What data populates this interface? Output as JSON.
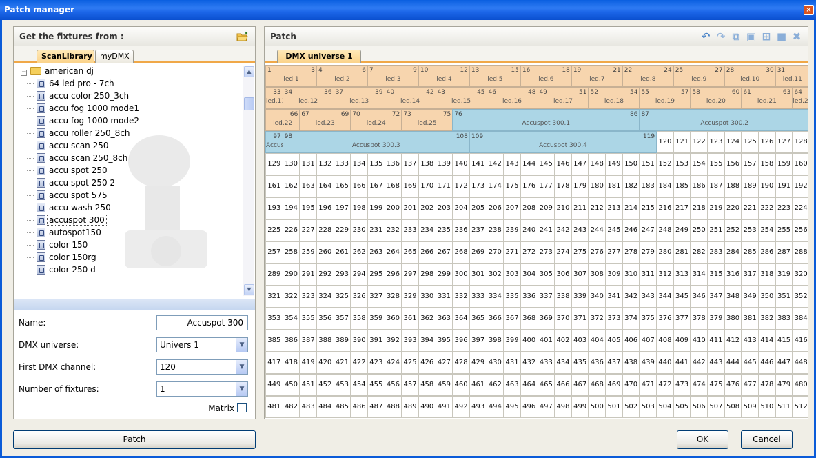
{
  "window": {
    "title": "Patch manager",
    "close_glyph": "×"
  },
  "left": {
    "header": "Get the fixtures from :",
    "tabs": [
      "ScanLibrary",
      "myDMX"
    ],
    "tree": {
      "root": "american dj",
      "items": [
        "64 led pro - 7ch",
        "accu color 250_3ch",
        "accu fog 1000 mode1",
        "accu fog 1000 mode2",
        "accu roller 250_8ch",
        "accu scan 250",
        "accu scan 250_8ch",
        "accu spot 250",
        "accu spot 250 2",
        "accu spot 575",
        "accu wash 250",
        "accuspot 300",
        "autospot150",
        "color 150",
        "color 150rg",
        "color 250 d"
      ],
      "selected": "accuspot 300"
    },
    "form": {
      "name_label": "Name:",
      "name_value": "Accuspot 300",
      "universe_label": "DMX universe:",
      "universe_value": "Univers 1",
      "channel_label": "First DMX channel:",
      "channel_value": "120",
      "count_label": "Number of fixtures:",
      "count_value": "1",
      "matrix_label": "Matrix"
    },
    "patch_button": "Patch"
  },
  "right": {
    "header": "Patch",
    "tab": "DMX universe 1",
    "toolbar": [
      "undo-icon",
      "redo-icon",
      "copy-icon",
      "paste-icon",
      "insert-icon",
      "square-icon",
      "delete-icon"
    ],
    "ok_button": "OK",
    "cancel_button": "Cancel"
  },
  "patch_grid": {
    "channels_per_row": 32,
    "total_channels": 512,
    "patched": [
      {
        "label": "led.1",
        "start": 1,
        "end": 3
      },
      {
        "label": "led.2",
        "start": 4,
        "end": 6
      },
      {
        "label": "led.3",
        "start": 7,
        "end": 9
      },
      {
        "label": "led.4",
        "start": 10,
        "end": 12
      },
      {
        "label": "led.5",
        "start": 13,
        "end": 15
      },
      {
        "label": "led.6",
        "start": 16,
        "end": 18
      },
      {
        "label": "led.7",
        "start": 19,
        "end": 21
      },
      {
        "label": "led.8",
        "start": 22,
        "end": 24
      },
      {
        "label": "led.9",
        "start": 25,
        "end": 27
      },
      {
        "label": "led.10",
        "start": 28,
        "end": 30
      },
      {
        "label": "led.11",
        "start": 31,
        "end": 33
      },
      {
        "label": "led.12",
        "start": 34,
        "end": 36
      },
      {
        "label": "led.13",
        "start": 37,
        "end": 39
      },
      {
        "label": "led.14",
        "start": 40,
        "end": 42
      },
      {
        "label": "led.15",
        "start": 43,
        "end": 45
      },
      {
        "label": "led.16",
        "start": 46,
        "end": 48
      },
      {
        "label": "led.17",
        "start": 49,
        "end": 51
      },
      {
        "label": "led.18",
        "start": 52,
        "end": 54
      },
      {
        "label": "led.19",
        "start": 55,
        "end": 57
      },
      {
        "label": "led.20",
        "start": 58,
        "end": 60
      },
      {
        "label": "led.21",
        "start": 61,
        "end": 63
      },
      {
        "label": "led.22",
        "start": 64,
        "end": 66
      },
      {
        "label": "led.23",
        "start": 67,
        "end": 69
      },
      {
        "label": "led.24",
        "start": 70,
        "end": 72
      },
      {
        "label": "led.25",
        "start": 73,
        "end": 75
      },
      {
        "label": "Accuspot 300.1",
        "start": 76,
        "end": 86,
        "type": "blue"
      },
      {
        "label": "Accuspot 300.2",
        "start": 87,
        "end": 97,
        "type": "blue"
      },
      {
        "label": "Accuspot 300.3",
        "start": 98,
        "end": 108,
        "type": "blue"
      },
      {
        "label": "Accuspot 300.4",
        "start": 109,
        "end": 119,
        "type": "blue"
      }
    ]
  }
}
